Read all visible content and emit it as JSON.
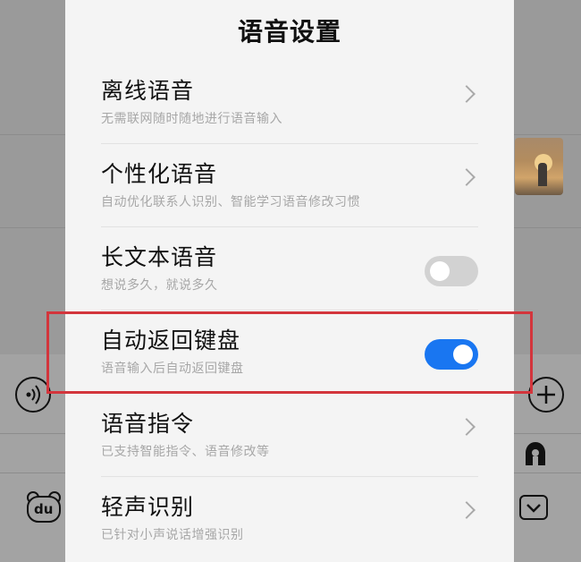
{
  "sheet": {
    "title": "语音设置",
    "rows": [
      {
        "label": "离线语音",
        "sub": "无需联网随时随地进行语音输入",
        "control": "chevron"
      },
      {
        "label": "个性化语音",
        "sub": "自动优化联系人识别、智能学习语音修改习惯",
        "control": "chevron"
      },
      {
        "label": "长文本语音",
        "sub": "想说多久，就说多久",
        "control": "toggle",
        "toggle_on": false
      },
      {
        "label": "自动返回键盘",
        "sub": "语音输入后自动返回键盘",
        "control": "toggle",
        "toggle_on": true
      },
      {
        "label": "语音指令",
        "sub": "已支持智能指令、语音修改等",
        "control": "chevron"
      },
      {
        "label": "轻声识别",
        "sub": "已针对小声说话增强识别",
        "control": "chevron"
      }
    ]
  },
  "background": {
    "left_icons": [
      "voice-wave-icon",
      "du-bear-icon"
    ],
    "right_icons": [
      "plus-circle-icon",
      "person-icon",
      "keyboard-collapse-icon"
    ],
    "du_label": "du"
  },
  "colors": {
    "toggle_on": "#1976f1",
    "toggle_off": "#d2d2d2",
    "highlight": "#d3353c"
  }
}
